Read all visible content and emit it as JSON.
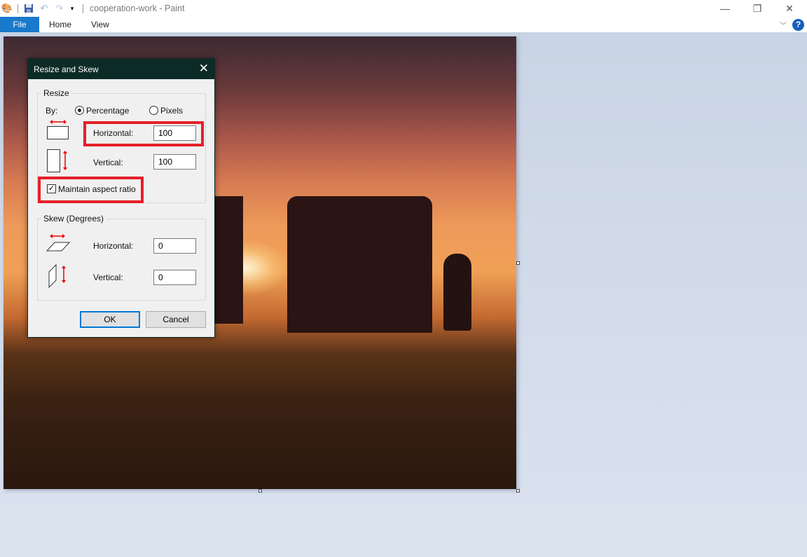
{
  "app": {
    "document_title": "cooperation-work - Paint",
    "quick_access": [
      "paint-app-icon",
      "save-icon",
      "undo-icon",
      "redo-icon",
      "customize-qat-icon"
    ],
    "window_controls": {
      "minimize": "—",
      "restore": "❐",
      "close": "✕"
    }
  },
  "ribbon": {
    "tabs": [
      {
        "label": "File",
        "active": true
      },
      {
        "label": "Home"
      },
      {
        "label": "View"
      }
    ],
    "help_label": "?",
    "collapse_icon": "chevron-down-icon",
    "accent": "#1979ca"
  },
  "dialog": {
    "title": "Resize and Skew",
    "close_glyph": "✕",
    "resize": {
      "legend": "Resize",
      "by_label": "By:",
      "options": [
        {
          "label": "Percentage",
          "selected": true
        },
        {
          "label": "Pixels",
          "selected": false
        }
      ],
      "horizontal_label": "Horizontal:",
      "horizontal_value": "100",
      "vertical_label": "Vertical:",
      "vertical_value": "100",
      "maintain_aspect_label": "Maintain aspect ratio",
      "maintain_aspect_checked": true
    },
    "skew": {
      "legend": "Skew (Degrees)",
      "horizontal_label": "Horizontal:",
      "horizontal_value": "0",
      "vertical_label": "Vertical:",
      "vertical_value": "0"
    },
    "ok_label": "OK",
    "cancel_label": "Cancel",
    "highlight_color": "#e4202a"
  },
  "canvas": {
    "image_description": "Silhouette of a man pushing a giant puzzle piece at sunset on a grassy hill"
  }
}
